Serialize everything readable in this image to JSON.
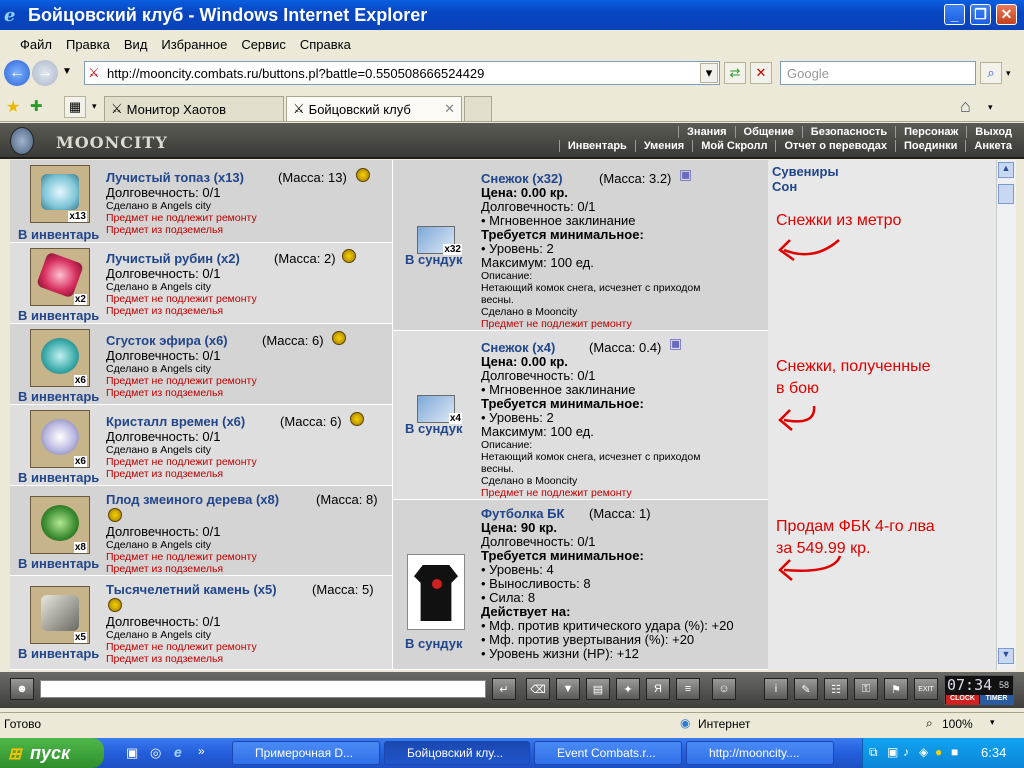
{
  "window": {
    "title": "Бойцовский клуб - Windows Internet Explorer"
  },
  "menu": [
    "Файл",
    "Правка",
    "Вид",
    "Избранное",
    "Сервис",
    "Справка"
  ],
  "address": {
    "url": "http://mooncity.combats.ru/buttons.pl?battle=0.550508666524429",
    "search_placeholder": "Google"
  },
  "tabs": [
    {
      "label": "Монитор Хаотов"
    },
    {
      "label": "Бойцовский клуб"
    }
  ],
  "game": {
    "logo": "MOONCITY",
    "top_menu": [
      "Знания",
      "Общение",
      "Безопасность",
      "Персонаж",
      "Выход"
    ],
    "sub_menu": [
      "Инвентарь",
      "Умения",
      "Мой Скролл",
      "Отчет о переводах",
      "Поединки",
      "Анкета"
    ]
  },
  "inventory": {
    "action_label": "В инвентарь",
    "durability": "Долговечность: 0/1",
    "made_in": "Сделано в Angels city",
    "no_repair": "Предмет не подлежит ремонту",
    "from_underground": "Предмет из подземелья",
    "items": [
      {
        "name": "Лучистый топаз (x13)",
        "mass": "(Масса: 13)",
        "count": "x13",
        "color": "#7fc6d8"
      },
      {
        "name": "Лучистый рубин (x2)",
        "mass": "(Масса: 2)",
        "count": "x2",
        "color": "#d83060"
      },
      {
        "name": "Сгусток эфира (x6)",
        "mass": "(Масса: 6)",
        "count": "x6",
        "color": "#3aa8a8"
      },
      {
        "name": "Кристалл времен (x6)",
        "mass": "(Масса: 6)",
        "count": "x6",
        "color": "#b8b8e0"
      },
      {
        "name": "Плод змеиного дерева (x8)",
        "mass": "(Масса: 8)",
        "count": "x8",
        "color": "#3a8a30"
      },
      {
        "name": "Тысячелетний камень (x5)",
        "mass": "(Масса: 5)",
        "count": "x5",
        "color": "#a8a8a0"
      }
    ]
  },
  "chest": {
    "action_label": "В сундук",
    "items": [
      {
        "name": "Снежок (x32)",
        "mass": "(Масса: 3.2)",
        "count": "x32",
        "price": "Цена: 0.00 кр.",
        "durability": "Долговечность: 0/1",
        "instant": "• Мгновенное заклинание",
        "req": "Требуется минимальное:",
        "level": "• Уровень: 2",
        "max": "Максимум: 100 ед.",
        "desc_label": "Описание:",
        "desc1": "Нетающий комок снега, исчезнет с приходом",
        "desc2": "весны.",
        "made_in": "Сделано в Mooncity",
        "no_repair": "Предмет не подлежит ремонту"
      },
      {
        "name": "Снежок (x4)",
        "mass": "(Масса: 0.4)",
        "count": "x4",
        "price": "Цена: 0.00 кр.",
        "durability": "Долговечность: 0/1",
        "instant": "• Мгновенное заклинание",
        "req": "Требуется минимальное:",
        "level": "• Уровень: 2",
        "max": "Максимум: 100 ед.",
        "desc_label": "Описание:",
        "desc1": "Нетающий комок снега, исчезнет с приходом",
        "desc2": "весны.",
        "made_in": "Сделано в Mooncity",
        "no_repair": "Предмет не подлежит ремонту"
      },
      {
        "name": "Футболка БК",
        "mass": "(Масса: 1)",
        "price": "Цена: 90 кр.",
        "durability": "Долговечность: 0/1",
        "req": "Требуется минимальное:",
        "level": "• Уровень: 4",
        "stamina": "• Выносливость: 8",
        "strength": "• Сила: 8",
        "acts": "Действует на:",
        "mf_crit": "• Мф. против критического удара (%): +20",
        "mf_dodge": "• Мф. против увертывания (%): +20",
        "hp": "• Уровень жизни (HP): +12"
      }
    ]
  },
  "right_panel": {
    "links": [
      "Сувениры",
      "Сон"
    ],
    "notes": [
      "Снежки из метро",
      "Снежки, полученные\nв бою",
      "Продам ФБК 4-го лва\nза 549.99 кр."
    ],
    "note_color": "#e00000"
  },
  "gamebar": {
    "clock": "07:34",
    "clock_sec": "58",
    "clock_label": "CLOCK",
    "timer_label": "TIMER",
    "exit_label": "EXIT"
  },
  "status": {
    "text": "Готово",
    "zone": "Интернет",
    "zoom": "100%"
  },
  "taskbar": {
    "start": "пуск",
    "tasks": [
      "Примерочная D...",
      "Бойцовский клу...",
      "Event Combats.r...",
      "http://mooncity...."
    ],
    "time": "6:34"
  }
}
